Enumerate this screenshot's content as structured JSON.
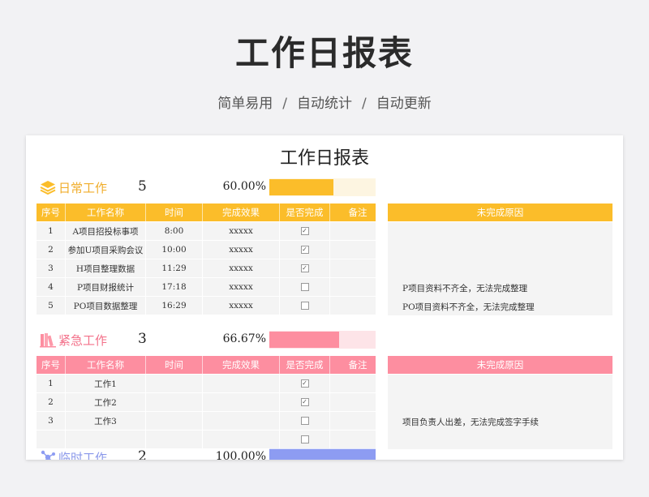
{
  "hero": {
    "title": "工作日报表",
    "sub": [
      "简单易用",
      "自动统计",
      "自动更新"
    ],
    "sep": "/"
  },
  "sheet": {
    "title": "工作日报表",
    "headers": [
      "序号",
      "工作名称",
      "时间",
      "完成效果",
      "是否完成",
      "备注"
    ],
    "reason_header": "未完成原因",
    "sections": [
      {
        "name": "日常工作",
        "count": "5",
        "percent": "60.00%",
        "progress": 0.6,
        "icon": "stack-layers-icon",
        "color": "#fbbd2a",
        "light": "#fdf5e1",
        "text_color": "#f0ad2b",
        "rows": [
          {
            "no": "1",
            "name": "A项目招投标事项",
            "time": "8:00",
            "effect": "xxxxx",
            "done": true,
            "note": "",
            "reason": ""
          },
          {
            "no": "2",
            "name": "参加U项目采购会议",
            "time": "10:00",
            "effect": "xxxxx",
            "done": true,
            "note": "",
            "reason": ""
          },
          {
            "no": "3",
            "name": "H项目整理数据",
            "time": "11:29",
            "effect": "xxxxx",
            "done": true,
            "note": "",
            "reason": ""
          },
          {
            "no": "4",
            "name": "P项目财报统计",
            "time": "17:18",
            "effect": "xxxxx",
            "done": false,
            "note": "",
            "reason": "P项目资料不齐全，无法完成整理"
          },
          {
            "no": "5",
            "name": "PO项目数据整理",
            "time": "16:29",
            "effect": "xxxxx",
            "done": false,
            "note": "",
            "reason": "PO项目资料不齐全，无法完成整理"
          }
        ]
      },
      {
        "name": "紧急工作",
        "count": "3",
        "percent": "66.67%",
        "progress": 0.6667,
        "icon": "books-icon",
        "color": "#fd8ea0",
        "light": "#fde4e8",
        "text_color": "#f3718a",
        "rows": [
          {
            "no": "1",
            "name": "工作1",
            "time": "",
            "effect": "",
            "done": true,
            "note": "",
            "reason": ""
          },
          {
            "no": "2",
            "name": "工作2",
            "time": "",
            "effect": "",
            "done": true,
            "note": "",
            "reason": ""
          },
          {
            "no": "3",
            "name": "工作3",
            "time": "",
            "effect": "",
            "done": false,
            "note": "",
            "reason": "项目负责人出差，无法完成签字手续"
          },
          {
            "no": "",
            "name": "",
            "time": "",
            "effect": "",
            "done": false,
            "note": "",
            "reason": ""
          }
        ]
      },
      {
        "name": "临时工作",
        "count": "2",
        "percent": "100.00%",
        "progress": 1.0,
        "icon": "network-nodes-icon",
        "color": "#8d9cf2",
        "light": "#e4e8fc",
        "text_color": "#8a98ea",
        "rows": []
      }
    ]
  }
}
